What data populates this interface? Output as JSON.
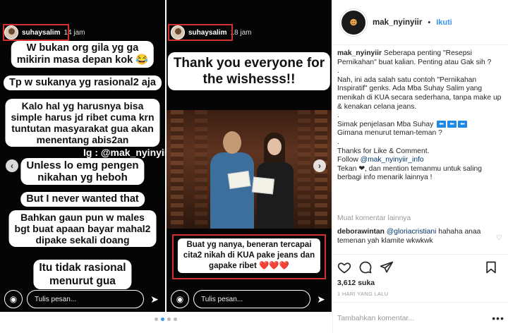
{
  "left_story": {
    "username": "suhaysalim",
    "time": "14 jam",
    "lines": [
      "W bukan org gila yg ga\nmikirin masa depan kok 😂",
      "Tp w sukanya yg rasional2 aja",
      "Kalo hal yg harusnya bisa\nsimple harus jd ribet cuma krn\ntuntutan masyarakat gua akan\nmenentang abis2an",
      "Unless lo emg pengen\nnikahan yg heboh",
      "But I never wanted that",
      "Bahkan gaun pun w males\nbgt buat apaan bayar mahal2\ndipake sekali doang",
      "Itu tidak rasional\nmenurut gua"
    ],
    "watermark": "Ig : @mak_nyinyiir",
    "message_placeholder": "Tulis pesan..."
  },
  "right_story": {
    "username": "suhaysalim",
    "time": "18 jam",
    "title": "Thank you everyone for\nthe wishesss!!",
    "caption": "Buat yg nanya, beneran tercapai\ncita2 nikah di KUA pake jeans dan\ngapake ribet ❤️❤️❤️",
    "message_placeholder": "Tulis pesan..."
  },
  "carousel": {
    "prev_icon": "‹",
    "next_icon": "›",
    "dots": 4,
    "active_dot": 2
  },
  "post": {
    "username": "mak_nyinyiir",
    "separator": "•",
    "follow_label": "Ikuti",
    "caption_user": "mak_nyinyiir",
    "caption_lines": [
      "Seberapa penting \"Resepsi Pernikahan\" buat kalian. Penting atau Gak sih ?",
      ".",
      "Nah, ini ada salah satu contoh \"Pernikahan Inspiratif\" genks. Ada Mba Suhay Salim yang menikah di KUA secara sederhana, tanpa make up & kenakan celana jeans.",
      ".",
      "Simak penjelasan Mba Suhay",
      "Gimana menurut teman-teman ?",
      ".",
      "Thanks for Like & Comment."
    ],
    "follow_text": "Follow",
    "follow_handle": "@mak_nyinyiir_info",
    "tag_text": "Tekan ❤, dan mention temanmu untuk saling berbagi info menarik lainnya !",
    "more_comments": "Muat komentar lainnya",
    "comment": {
      "user": "deborawintan",
      "mention": "@gloriacristiani",
      "text": "hahaha anaa temenan yah klamite wkwkwk"
    },
    "likes": "3,612 suka",
    "time_ago": "1 HARI YANG LALU",
    "add_comment_placeholder": "Tambahkan komentar...",
    "more_icon": "•••"
  }
}
